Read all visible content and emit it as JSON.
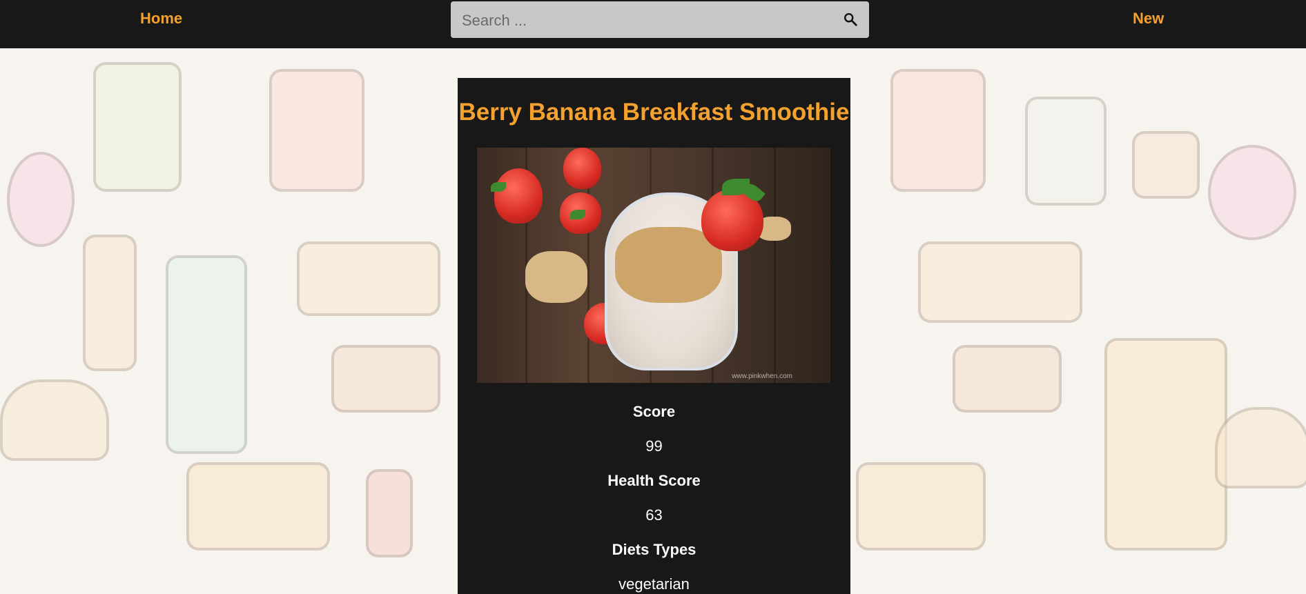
{
  "navbar": {
    "home_label": "Home",
    "new_label": "New",
    "search": {
      "placeholder": "Search ...",
      "value": ""
    },
    "background_color": "#181818",
    "link_color": "#f4a130"
  },
  "recipe": {
    "title": "Berry Banana Breakfast Smoothie",
    "image_watermark": "www.pinkwhen.com",
    "score_label": "Score",
    "score_value": "99",
    "health_score_label": "Health Score",
    "health_score_value": "63",
    "diets_label": "Diets Types",
    "diets_value": "vegetarian"
  },
  "icons": {
    "search": "search-icon"
  }
}
